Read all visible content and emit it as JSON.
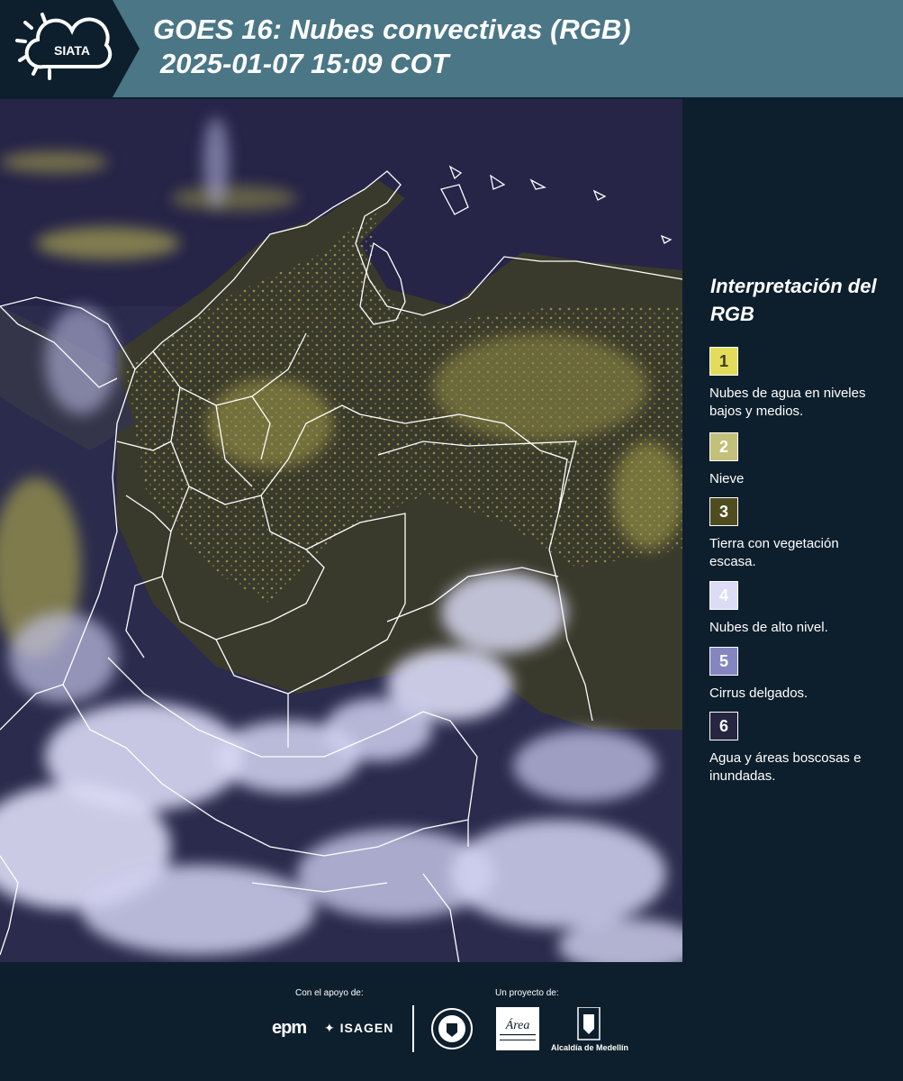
{
  "header": {
    "logo_text": "SIATA",
    "title": "GOES 16: Nubes convectivas (RGB)",
    "subtitle": "2025-01-07 15:09 COT"
  },
  "map": {
    "layer": "Nubes convectivas (RGB)",
    "region": "Colombia"
  },
  "legend": {
    "title": "Interpretación del RGB",
    "items": [
      {
        "number": "1",
        "color": "#e2dc5a",
        "text_color": "#3a3a20",
        "label": "Nubes de agua en niveles bajos y medios."
      },
      {
        "number": "2",
        "color": "#c3c07a",
        "text_color": "#ffffff",
        "label": "Nieve"
      },
      {
        "number": "3",
        "color": "#4f4d1f",
        "text_color": "#ffffff",
        "label": "Tierra con vegetación escasa."
      },
      {
        "number": "4",
        "color": "#dcdcf4",
        "text_color": "#ffffff",
        "label": "Nubes de alto nivel."
      },
      {
        "number": "5",
        "color": "#8585c2",
        "text_color": "#ffffff",
        "label": "Cirrus delgados."
      },
      {
        "number": "6",
        "color": "#262640",
        "text_color": "#ffffff",
        "label": "Agua y áreas boscosas e inundadas."
      }
    ]
  },
  "footer": {
    "support_label": "Con el apoyo de:",
    "project_label": "Un proyecto de:",
    "sponsor1": "epm",
    "sponsor2": "ISAGEN",
    "partner_area": "Área Metropolitana Valle de Aburrá",
    "partner_alcaldia": "Alcaldía de Medellín"
  }
}
